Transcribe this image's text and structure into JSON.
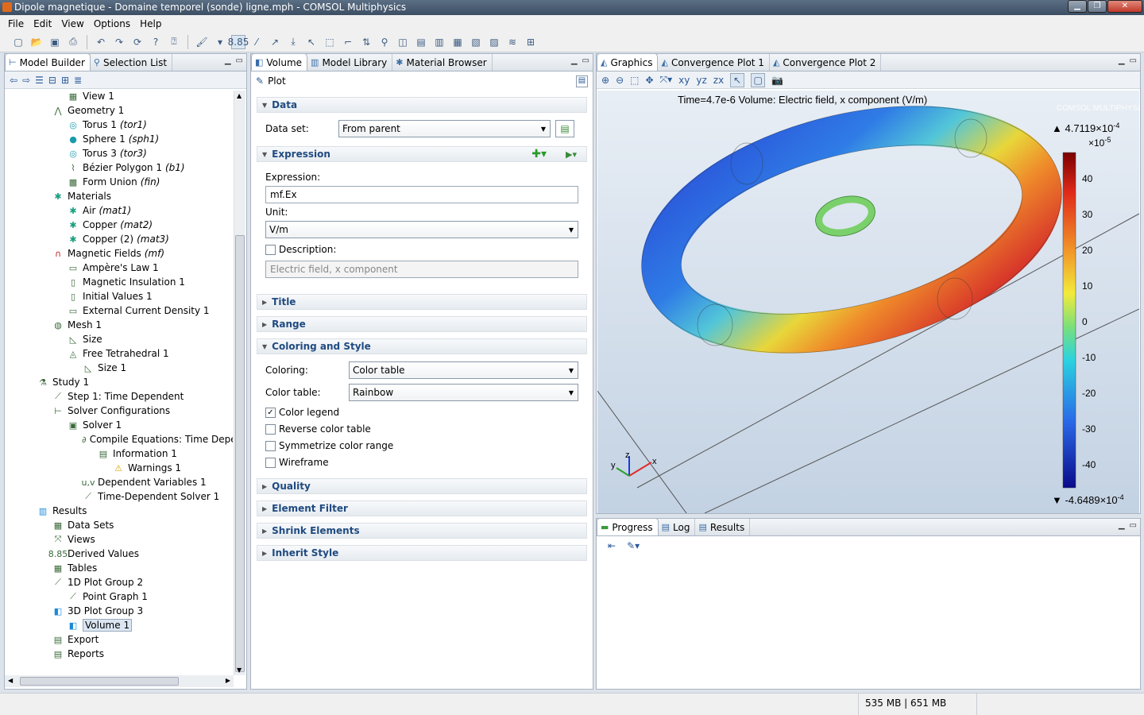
{
  "window": {
    "title": "Dipole magnetique - Domaine temporel (sonde) ligne.mph - COMSOL Multiphysics"
  },
  "menu": [
    "File",
    "Edit",
    "View",
    "Options",
    "Help"
  ],
  "left_panel": {
    "tabs": [
      "Model Builder",
      "Selection List"
    ],
    "tree": [
      {
        "label": "View 1",
        "tag": "",
        "indent": 3,
        "icon": "view-icon"
      },
      {
        "label": "Geometry 1",
        "tag": "",
        "indent": 2,
        "icon": "geometry-icon"
      },
      {
        "label": "Torus 1",
        "tag": "(tor1)",
        "indent": 3,
        "icon": "torus-icon"
      },
      {
        "label": "Sphere 1",
        "tag": "(sph1)",
        "indent": 3,
        "icon": "sphere-icon"
      },
      {
        "label": "Torus 3",
        "tag": "(tor3)",
        "indent": 3,
        "icon": "torus-icon"
      },
      {
        "label": "Bézier Polygon 1",
        "tag": "(b1)",
        "indent": 3,
        "icon": "bezier-icon"
      },
      {
        "label": "Form Union",
        "tag": "(fin)",
        "indent": 3,
        "icon": "union-icon"
      },
      {
        "label": "Materials",
        "tag": "",
        "indent": 2,
        "icon": "materials-icon"
      },
      {
        "label": "Air",
        "tag": "(mat1)",
        "indent": 3,
        "icon": "material-icon"
      },
      {
        "label": "Copper",
        "tag": "(mat2)",
        "indent": 3,
        "icon": "material-icon"
      },
      {
        "label": "Copper (2)",
        "tag": "(mat3)",
        "indent": 3,
        "icon": "material-icon"
      },
      {
        "label": "Magnetic Fields",
        "tag": "(mf)",
        "indent": 2,
        "icon": "magnet-icon"
      },
      {
        "label": "Ampère's Law 1",
        "tag": "",
        "indent": 3,
        "icon": "domain-icon"
      },
      {
        "label": "Magnetic Insulation 1",
        "tag": "",
        "indent": 3,
        "icon": "boundary-icon"
      },
      {
        "label": "Initial Values 1",
        "tag": "",
        "indent": 3,
        "icon": "boundary-icon"
      },
      {
        "label": "External Current Density 1",
        "tag": "",
        "indent": 3,
        "icon": "domain-icon"
      },
      {
        "label": "Mesh 1",
        "tag": "",
        "indent": 2,
        "icon": "mesh-icon"
      },
      {
        "label": "Size",
        "tag": "",
        "indent": 3,
        "icon": "size-icon"
      },
      {
        "label": "Free Tetrahedral 1",
        "tag": "",
        "indent": 3,
        "icon": "tetra-icon"
      },
      {
        "label": "Size 1",
        "tag": "",
        "indent": 4,
        "icon": "size-icon"
      },
      {
        "label": "Study 1",
        "tag": "",
        "indent": 1,
        "icon": "study-icon"
      },
      {
        "label": "Step 1: Time Dependent",
        "tag": "",
        "indent": 2,
        "icon": "step-icon"
      },
      {
        "label": "Solver Configurations",
        "tag": "",
        "indent": 2,
        "icon": "solver-config-icon"
      },
      {
        "label": "Solver 1",
        "tag": "",
        "indent": 3,
        "icon": "solver-icon"
      },
      {
        "label": "Compile Equations: Time Depen",
        "tag": "",
        "indent": 4,
        "icon": "compile-icon"
      },
      {
        "label": "Information 1",
        "tag": "",
        "indent": 5,
        "icon": "info-icon"
      },
      {
        "label": "Warnings 1",
        "tag": "",
        "indent": 6,
        "icon": "warning-icon"
      },
      {
        "label": "Dependent Variables 1",
        "tag": "",
        "indent": 4,
        "icon": "variables-icon"
      },
      {
        "label": "Time-Dependent Solver 1",
        "tag": "",
        "indent": 4,
        "icon": "time-solver-icon"
      },
      {
        "label": "Results",
        "tag": "",
        "indent": 1,
        "icon": "results-icon"
      },
      {
        "label": "Data Sets",
        "tag": "",
        "indent": 2,
        "icon": "datasets-icon"
      },
      {
        "label": "Views",
        "tag": "",
        "indent": 2,
        "icon": "views-icon"
      },
      {
        "label": "Derived Values",
        "tag": "",
        "indent": 2,
        "icon": "derived-icon"
      },
      {
        "label": "Tables",
        "tag": "",
        "indent": 2,
        "icon": "table-icon"
      },
      {
        "label": "1D Plot Group 2",
        "tag": "",
        "indent": 2,
        "icon": "plot1d-icon"
      },
      {
        "label": "Point Graph 1",
        "tag": "",
        "indent": 3,
        "icon": "graph-icon"
      },
      {
        "label": "3D Plot Group 3",
        "tag": "",
        "indent": 2,
        "icon": "plot3d-icon"
      },
      {
        "label": "Volume 1",
        "tag": "",
        "indent": 3,
        "icon": "volume-icon",
        "selected": true
      },
      {
        "label": "Export",
        "tag": "",
        "indent": 2,
        "icon": "export-icon"
      },
      {
        "label": "Reports",
        "tag": "",
        "indent": 2,
        "icon": "reports-icon"
      }
    ]
  },
  "mid_panel": {
    "tabs": [
      "Volume",
      "Model Library",
      "Material Browser"
    ],
    "header": "Plot",
    "sections": {
      "data": "Data",
      "expression": "Expression",
      "title": "Title",
      "range": "Range",
      "coloring": "Coloring and Style",
      "quality": "Quality",
      "element_filter": "Element Filter",
      "shrink": "Shrink Elements",
      "inherit": "Inherit Style"
    },
    "dataset_label": "Data set:",
    "dataset_value": "From parent",
    "expression_label": "Expression:",
    "expression_value": "mf.Ex",
    "unit_label": "Unit:",
    "unit_value": "V/m",
    "description_label": "Description:",
    "description_value": "Electric field, x component",
    "coloring_label": "Coloring:",
    "coloring_value": "Color table",
    "colortable_label": "Color table:",
    "colortable_value": "Rainbow",
    "checks": {
      "color_legend": "Color legend",
      "reverse": "Reverse color table",
      "symmetrize": "Symmetrize color range",
      "wireframe": "Wireframe"
    },
    "color_legend_checked": true
  },
  "graphics": {
    "tabs": [
      "Graphics",
      "Convergence Plot 1",
      "Convergence Plot 2"
    ],
    "caption": "Time=4.7e-6   Volume: Electric field, x component (V/m)",
    "watermark": "COMSOL MULTIPHYSICS",
    "legend_max": "▲ 4.7119×10",
    "legend_max_exp": "-4",
    "legend_scale": "×10",
    "legend_scale_exp": "-5",
    "legend_min": "▼ -4.6489×10",
    "legend_min_exp": "-4",
    "legend_ticks": [
      "40",
      "30",
      "20",
      "10",
      "0",
      "-10",
      "-20",
      "-30",
      "-40"
    ],
    "axes": {
      "x": "x",
      "y": "y",
      "z": "z"
    }
  },
  "bottom_panel": {
    "tabs": [
      "Progress",
      "Log",
      "Results"
    ]
  },
  "status": {
    "memory": "535 MB | 651 MB"
  }
}
